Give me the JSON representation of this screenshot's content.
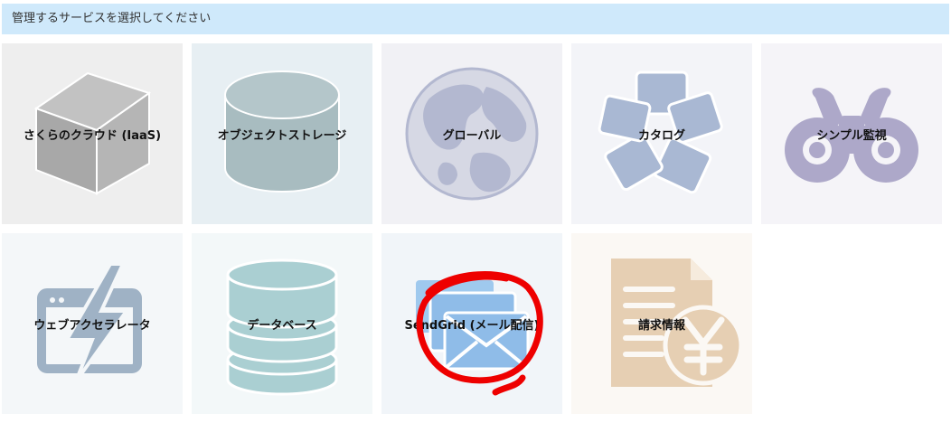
{
  "header": {
    "title": "管理するサービスを選択してください"
  },
  "services": [
    {
      "label": "さくらのクラウド (IaaS)",
      "icon": "cube-icon"
    },
    {
      "label": "オブジェクトストレージ",
      "icon": "cylinder-icon"
    },
    {
      "label": "グローバル",
      "icon": "globe-icon"
    },
    {
      "label": "カタログ",
      "icon": "catalog-icon"
    },
    {
      "label": "シンプル監視",
      "icon": "binoculars-icon"
    },
    {
      "label": "ウェブアクセラレータ",
      "icon": "lightning-window-icon"
    },
    {
      "label": "データベース",
      "icon": "database-icon"
    },
    {
      "label": "SendGrid (メール配信)",
      "icon": "mail-icon"
    },
    {
      "label": "請求情報",
      "icon": "yen-document-icon"
    }
  ],
  "colors": {
    "header_bg": "#cfe9fb",
    "cube": "#b0b0b0",
    "storage": "#a8bcc0",
    "globe": "#b3b8d0",
    "catalog": "#a9b8d3",
    "binoculars": "#ada8c9",
    "accelerator": "#9fb2c5",
    "database": "#aacfd2",
    "mail": "#8fbce8",
    "invoice": "#e6cfb3",
    "annotation": "#ee0000"
  }
}
